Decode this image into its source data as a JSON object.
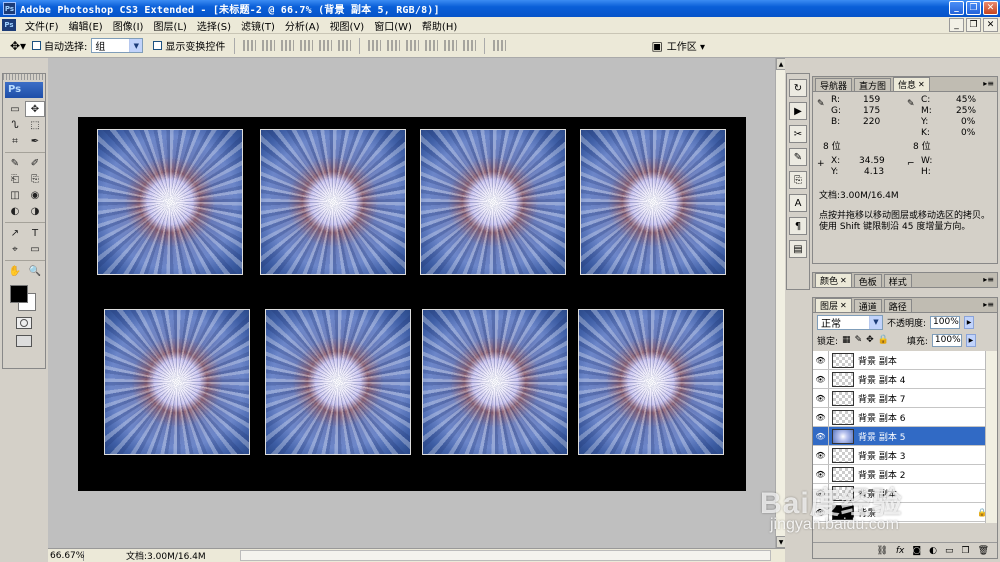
{
  "window": {
    "app_icon": "Ps",
    "title": "Adobe Photoshop CS3 Extended - [未标题-2 @ 66.7% (背景 副本 5, RGB/8)]",
    "buttons": [
      "_",
      "❐",
      "✕"
    ]
  },
  "menu": {
    "items": [
      "文件(F)",
      "编辑(E)",
      "图像(I)",
      "图层(L)",
      "选择(S)",
      "滤镜(T)",
      "分析(A)",
      "视图(V)",
      "窗口(W)",
      "帮助(H)"
    ],
    "doc_buttons": [
      "_",
      "❐",
      "✕"
    ]
  },
  "options": {
    "auto_select_label": "自动选择:",
    "auto_select_value": "组",
    "show_transform_label": "显示变换控件",
    "workspace_label": "工作区 ▾"
  },
  "toolbox": {
    "logo": "Ps",
    "tools": [
      "▭",
      "✥",
      "ᔐ",
      "⬚",
      "⌗",
      "✒",
      "✎",
      "✐",
      "⎗",
      "⎘",
      "◫",
      "◉",
      "◐",
      "◑",
      "↗",
      "T",
      "⌖",
      "▭",
      "✋",
      "🔍"
    ]
  },
  "status": {
    "zoom": "66.67%",
    "doc_info": "文档:3.00M/16.4M"
  },
  "info_panel": {
    "tabs": [
      {
        "label": "导航器"
      },
      {
        "label": "直方图"
      },
      {
        "label": "信息",
        "active": true
      }
    ],
    "rgb": {
      "R": "159",
      "G": "175",
      "B": "220"
    },
    "cmyk": {
      "C": "45%",
      "M": "25%",
      "Y": "0%",
      "K": "0%"
    },
    "bit_left": "8 位",
    "bit_right": "8 位",
    "xy": {
      "X": "34.59",
      "Y": "4.13"
    },
    "wh": {
      "W": "",
      "H": ""
    },
    "doc": "文档:3.00M/16.4M",
    "hint_line1": "点按并拖移以移动图层或移动选区的拷贝。",
    "hint_line2": "使用 Shift 键限制沿 45 度增量方向。"
  },
  "color_panel": {
    "tabs": [
      {
        "label": "颜色",
        "active": true
      },
      {
        "label": "色板"
      },
      {
        "label": "样式"
      }
    ]
  },
  "layers_panel": {
    "tabs": [
      {
        "label": "图层",
        "active": true
      },
      {
        "label": "通道"
      },
      {
        "label": "路径"
      }
    ],
    "blend_mode": "正常",
    "opacity_label": "不透明度:",
    "opacity": "100%",
    "lock_label": "锁定:",
    "fill_label": "填充:",
    "fill": "100%",
    "layers": [
      {
        "name": "背景 副本",
        "thumb": "trans",
        "active": false
      },
      {
        "name": "背景 副本 4",
        "thumb": "trans",
        "active": false
      },
      {
        "name": "背景 副本 7",
        "thumb": "trans",
        "active": false
      },
      {
        "name": "背景 副本 6",
        "thumb": "trans",
        "active": false
      },
      {
        "name": "背景 副本 5",
        "thumb": "img",
        "active": true
      },
      {
        "name": "背景 副本 3",
        "thumb": "trans",
        "active": false
      },
      {
        "name": "背景 副本 2",
        "thumb": "trans",
        "active": false
      },
      {
        "name": "背景 副本",
        "thumb": "trans",
        "active": false
      },
      {
        "name": "背景",
        "thumb": "black",
        "active": false,
        "locked": true
      }
    ],
    "footer_icons": [
      "link-icon",
      "fx-icon",
      "mask-icon",
      "adjustment-icon",
      "folder-icon",
      "new-layer-icon",
      "trash-icon"
    ]
  },
  "watermark": {
    "line1": "Bai度经验",
    "line2": "jingyan.baidu.com"
  }
}
